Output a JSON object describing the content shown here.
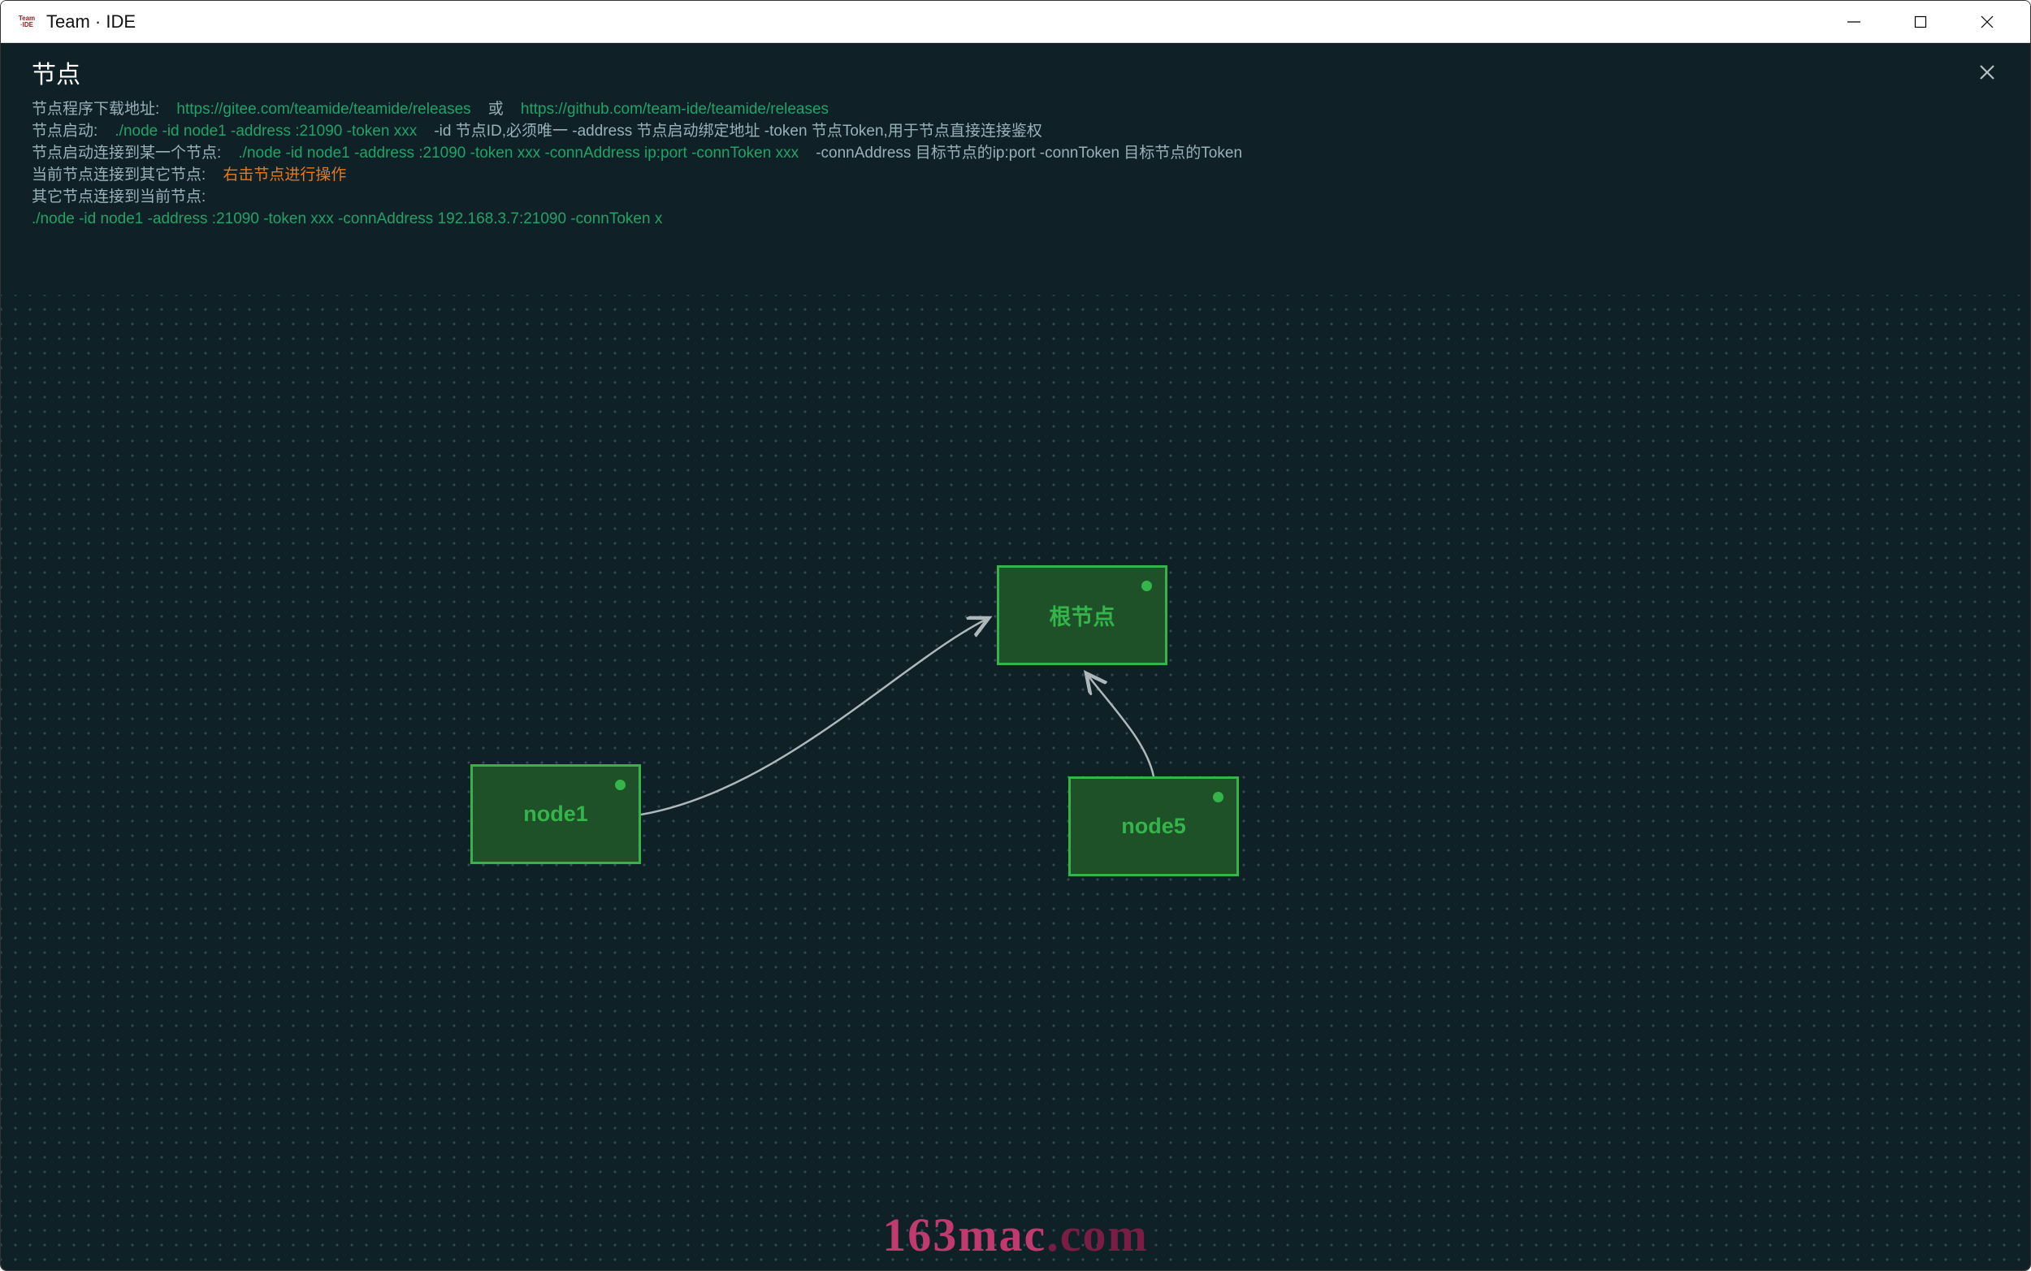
{
  "window": {
    "title": "Team · IDE",
    "icon_text": "Team\n·IDE"
  },
  "panel": {
    "title": "节点"
  },
  "info": {
    "line1": {
      "label": "节点程序下载地址:",
      "link1": "https://gitee.com/teamide/teamide/releases",
      "or": "或",
      "link2": "https://github.com/team-ide/teamide/releases"
    },
    "line2": {
      "label": "节点启动:",
      "cmd": "./node -id node1 -address :21090 -token xxx",
      "desc": "-id 节点ID,必须唯一 -address 节点启动绑定地址 -token 节点Token,用于节点直接连接鉴权"
    },
    "line3": {
      "label": "节点启动连接到某一个节点:",
      "cmd": "./node -id node1 -address :21090 -token xxx -connAddress ip:port -connToken xxx",
      "desc": "-connAddress 目标节点的ip:port -connToken 目标节点的Token"
    },
    "line4": {
      "label": "当前节点连接到其它节点:",
      "hint": "右击节点进行操作"
    },
    "line5": {
      "label": "其它节点连接到当前节点:"
    },
    "line6": {
      "cmd": "./node -id node1 -address :21090 -token xxx -connAddress 192.168.3.7:21090 -connToken x"
    }
  },
  "nodes": {
    "root": {
      "label": "根节点"
    },
    "n1": {
      "label": "node1"
    },
    "n5": {
      "label": "node5"
    }
  },
  "watermark": {
    "part1": "163mac",
    "part2": ".com"
  }
}
